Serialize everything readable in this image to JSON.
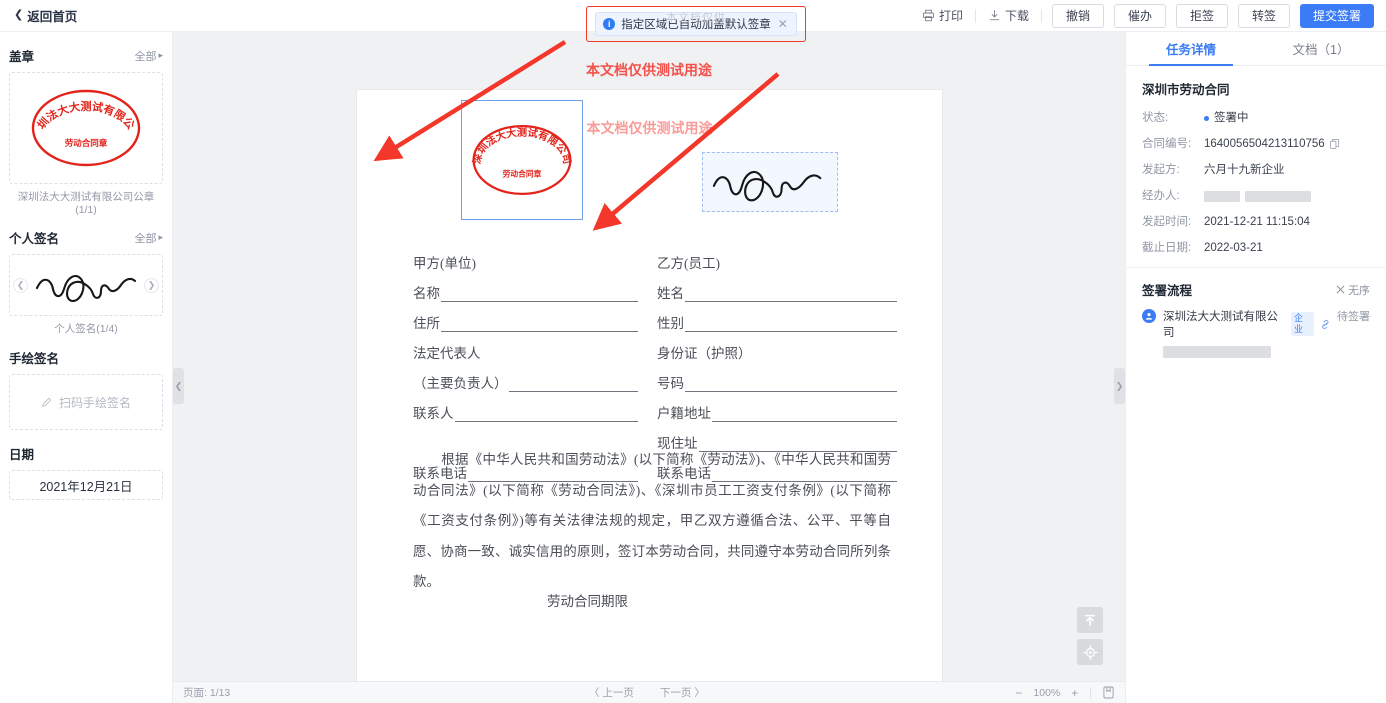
{
  "topbar": {
    "back_label": "返回首页",
    "print_label": "打印",
    "download_label": "下载",
    "buttons": [
      {
        "label": "撤销"
      },
      {
        "label": "催办"
      },
      {
        "label": "拒签"
      },
      {
        "label": "转签"
      }
    ],
    "primary_label": "提交签署"
  },
  "toast": {
    "message": "指定区域已自动加盖默认签章",
    "close": "✕",
    "info": "i",
    "ghost_text": "本文档仅供"
  },
  "sidebar": {
    "seal_section": {
      "title": "盖章",
      "all_label": "全部",
      "caption": "深圳法大大测试有限公司公章(1/1)",
      "seal_outer_text": "深圳法大大测试有限公司",
      "seal_inner_text": "劳动合同章"
    },
    "signature_section": {
      "title": "个人签名",
      "all_label": "全部",
      "caption": "个人签名(1/4)"
    },
    "handwrite_section": {
      "title": "手绘签名",
      "action_label": "扫码手绘签名"
    },
    "date_section": {
      "title": "日期",
      "value": "2021年12月21日"
    }
  },
  "document": {
    "watermark": "本文档仅供测试用途",
    "left_column": [
      {
        "label": "甲方(单位)",
        "line": false
      },
      {
        "label": "名称",
        "line": true
      },
      {
        "label": "住所",
        "line": true
      },
      {
        "label": "法定代表人",
        "line": false
      },
      {
        "label": "（主要负责人）",
        "line": true
      },
      {
        "label": "联系人",
        "line": true
      },
      {
        "label": "",
        "line": false
      },
      {
        "label": "联系电话",
        "line": true
      }
    ],
    "right_column": [
      {
        "label": "乙方(员工)",
        "line": false
      },
      {
        "label": "姓名",
        "line": true
      },
      {
        "label": "性别",
        "line": true
      },
      {
        "label": "身份证（护照）",
        "line": false
      },
      {
        "label": "号码",
        "line": true
      },
      {
        "label": "户籍地址",
        "line": true
      },
      {
        "label": "现住址",
        "line": true
      },
      {
        "label": "联系电话",
        "line": true
      }
    ],
    "paragraph": "根据《中华人民共和国劳动法》(以下简称《劳动法》)、《中华人民共和国劳动合同法》(以下简称《劳动合同法》)、《深圳市员工工资支付条例》(以下简称《工资支付条例》)等有关法律法规的规定，甲乙双方遵循合法、公平、平等自愿、协商一致、诚实信用的原则，签订本劳动合同，共同遵守本劳动合同所列条款。",
    "next_heading": "劳动合同期限"
  },
  "bottombar": {
    "page_label": "页面: 1/13",
    "prev_label": "〈 上一页",
    "next_label": "下一页 〉",
    "zoom_out": "−",
    "zoom_level": "100%",
    "zoom_in": "+"
  },
  "right_panel": {
    "tabs": [
      {
        "label": "任务详情",
        "active": true
      },
      {
        "label": "文档（1）",
        "active": false
      }
    ],
    "title": "深圳市劳动合同",
    "fields": [
      {
        "key": "状态:",
        "value": "签署中",
        "type": "status"
      },
      {
        "key": "合同编号:",
        "value": "1640056504213110756",
        "type": "copy"
      },
      {
        "key": "发起方:",
        "value": "六月十九新企业",
        "type": "text"
      },
      {
        "key": "经办人:",
        "value": "",
        "type": "redacted"
      },
      {
        "key": "发起时间:",
        "value": "2021-12-21 11:15:04",
        "type": "text"
      },
      {
        "key": "截止日期:",
        "value": "2022-03-21",
        "type": "text"
      }
    ],
    "flow": {
      "title": "签署流程",
      "order_label": "无序",
      "items": [
        {
          "name": "深圳法大大测试有限公司",
          "badge": "企业",
          "status": "待签署"
        }
      ]
    }
  }
}
